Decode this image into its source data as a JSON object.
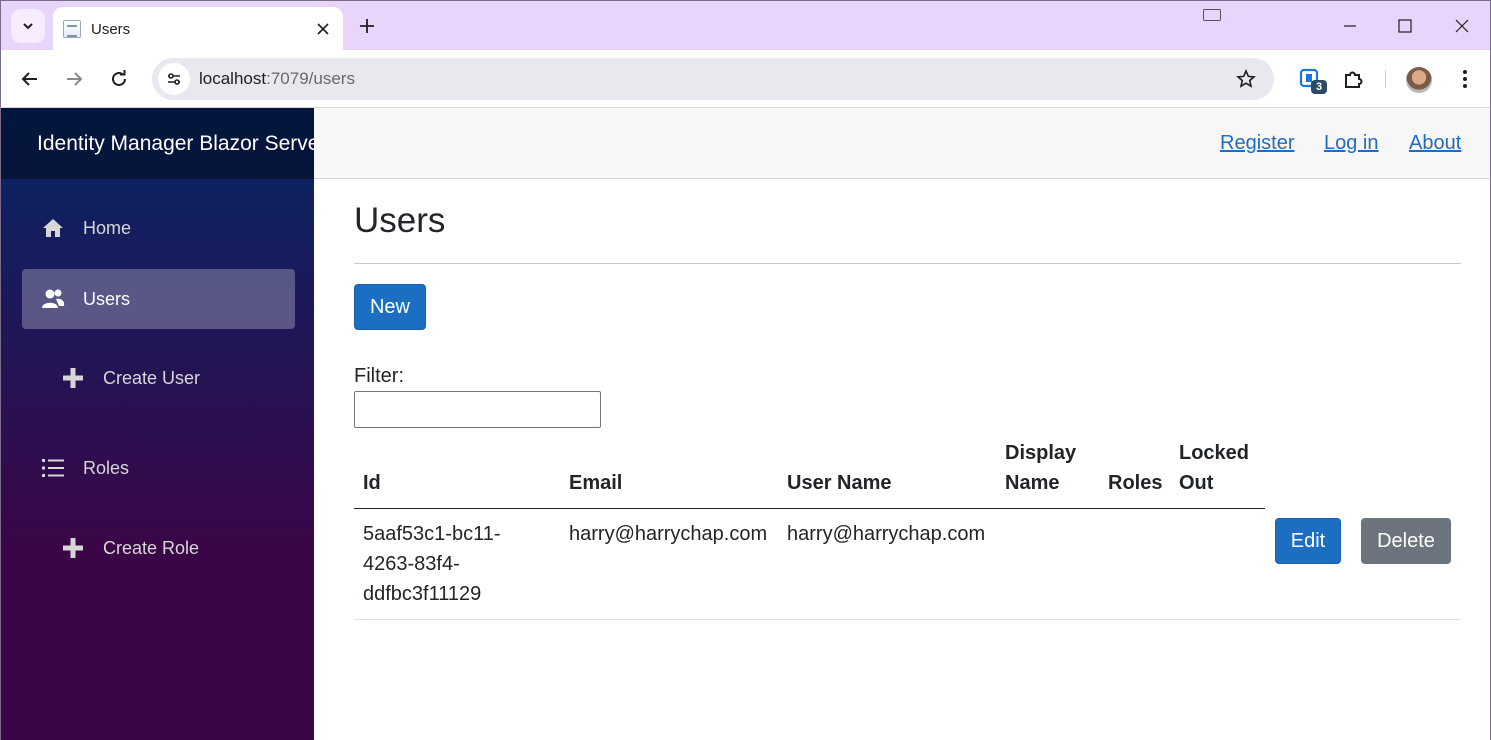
{
  "browser": {
    "tab_title": "Users",
    "url_host": "localhost",
    "url_path": ":7079/users",
    "extension_badge": "3"
  },
  "app": {
    "brand": "Identity Manager Blazor Server",
    "top_links": [
      "Register",
      "Log in",
      "About"
    ],
    "nav": [
      {
        "label": "Home",
        "icon": "home-icon"
      },
      {
        "label": "Users",
        "icon": "users-icon",
        "active": true
      },
      {
        "label": "Create User",
        "icon": "plus-icon"
      },
      {
        "label": "Roles",
        "icon": "list-icon"
      },
      {
        "label": "Create Role",
        "icon": "plus-icon"
      }
    ]
  },
  "page": {
    "title": "Users",
    "new_button": "New",
    "filter_label": "Filter:",
    "filter_value": ""
  },
  "table": {
    "headers": [
      "Id",
      "Email",
      "User Name",
      "Display\nName",
      "Roles",
      "Locked\nOut"
    ],
    "rows": [
      {
        "id": "5aaf53c1-bc11-4263-83f4-ddfbc3f11129",
        "id_lines": [
          "5aaf53c1-bc11-",
          "4263-83f4-",
          "ddfbc3f11129"
        ],
        "email": "harry@harrychap.com",
        "user_name": "harry@harrychap.com",
        "display_name": "",
        "roles": "",
        "locked_out": "",
        "edit_label": "Edit",
        "delete_label": "Delete"
      }
    ]
  },
  "colors": {
    "primary": "#1b6ec2",
    "secondary": "#6c757d",
    "sidebar_top": "#052767",
    "sidebar_bottom": "#3a0647",
    "titlebar": "#e9d5fb"
  }
}
